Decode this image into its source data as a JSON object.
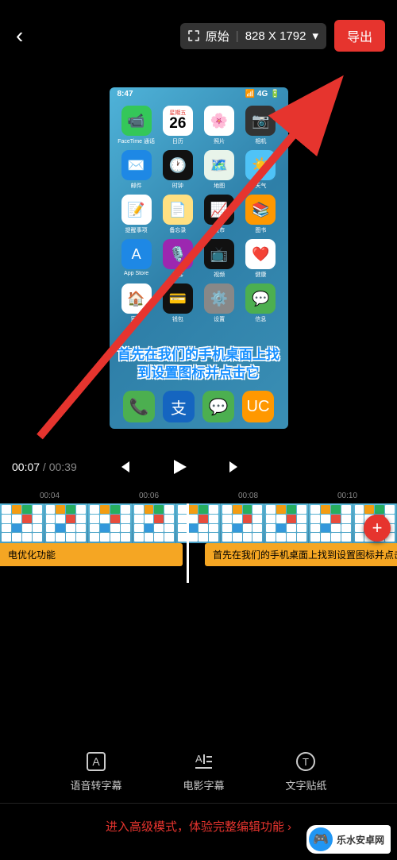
{
  "header": {
    "resolution_mode": "原始",
    "resolution_value": "828 X 1792",
    "export": "导出"
  },
  "preview": {
    "status_time": "8:47",
    "status_sig": "📶 4G 🔋",
    "calendar_weekday": "星期五",
    "calendar_day": "26",
    "apps": [
      {
        "label": "FaceTime 通话",
        "bg": "#34c759",
        "g": "📹"
      },
      {
        "label": "日历"
      },
      {
        "label": "照片",
        "bg": "#fff",
        "g": "🌸"
      },
      {
        "label": "相机",
        "bg": "#333",
        "g": "📷"
      },
      {
        "label": "邮件",
        "bg": "#1e88e5",
        "g": "✉️"
      },
      {
        "label": "时钟",
        "bg": "#111",
        "g": "🕐"
      },
      {
        "label": "地图",
        "bg": "#e8f4ea",
        "g": "🗺️"
      },
      {
        "label": "天气",
        "bg": "#4fc3f7",
        "g": "☀️"
      },
      {
        "label": "提醒事项",
        "bg": "#fff",
        "g": "📝"
      },
      {
        "label": "备忘录",
        "bg": "#ffe082",
        "g": "📄"
      },
      {
        "label": "股市",
        "bg": "#111",
        "g": "📈"
      },
      {
        "label": "图书",
        "bg": "#ff9800",
        "g": "📚"
      },
      {
        "label": "App Store",
        "bg": "#1e88e5",
        "g": "A"
      },
      {
        "label": "播客",
        "bg": "#9c27b0",
        "g": "🎙️"
      },
      {
        "label": "视频",
        "bg": "#111",
        "g": "📺"
      },
      {
        "label": "健康",
        "bg": "#fff",
        "g": "❤️"
      },
      {
        "label": "家庭",
        "bg": "#fff",
        "g": "🏠"
      },
      {
        "label": "钱包",
        "bg": "#111",
        "g": "💳"
      },
      {
        "label": "设置",
        "bg": "#888",
        "g": "⚙️"
      },
      {
        "label": "信息",
        "bg": "#4caf50",
        "g": "💬"
      }
    ],
    "subtitle": "首先在我们的手机桌面上找到设置图标并点击它",
    "dock": [
      {
        "bg": "#4caf50",
        "g": "📞"
      },
      {
        "bg": "#1565c0",
        "g": "支"
      },
      {
        "bg": "#4caf50",
        "g": "💬"
      },
      {
        "bg": "#ff9800",
        "g": "UC"
      }
    ]
  },
  "transport": {
    "current": "00:07",
    "total": "00:39"
  },
  "ruler": [
    "00:04",
    "00:06",
    "00:08",
    "00:10"
  ],
  "captions": {
    "left": "电优化功能",
    "right": "首先在我们的手机桌面上找到设置图标并点击它"
  },
  "tools": {
    "voice": "语音转字幕",
    "movie": "电影字幕",
    "sticker": "文字贴纸"
  },
  "advanced": "进入高级模式，体验完整编辑功能",
  "watermark": "乐水安卓网"
}
